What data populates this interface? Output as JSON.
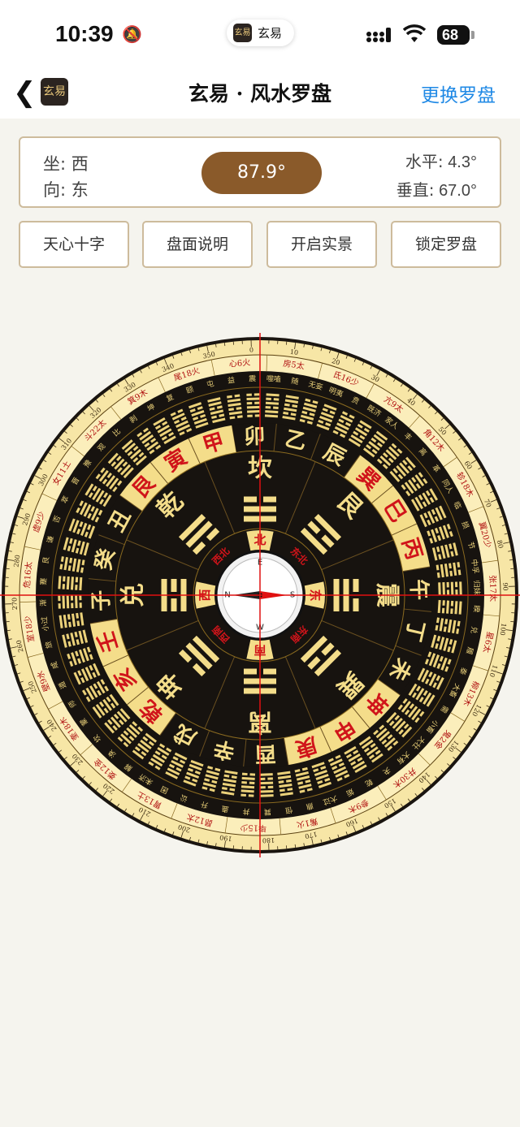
{
  "status": {
    "time": "10:39",
    "app_name": "玄易",
    "battery": "68"
  },
  "nav": {
    "logo": "玄易",
    "title": "玄易 · 风水罗盘",
    "right_action": "更换罗盘"
  },
  "info": {
    "sit_label": "坐:",
    "sit_value": "西",
    "face_label": "向:",
    "face_value": "东",
    "heading": "87.9°",
    "level_label": "水平:",
    "level_value": "4.3°",
    "vertical_label": "垂直:",
    "vertical_value": "67.0°"
  },
  "buttons": [
    "天心十字",
    "盘面说明",
    "开启实景",
    "锁定罗盘"
  ],
  "compass": {
    "cardinals": [
      "E",
      "S",
      "W",
      "N"
    ],
    "directions": [
      "东",
      "东南",
      "南",
      "西南",
      "西",
      "西北",
      "北",
      "东北"
    ],
    "trigrams": [
      "震",
      "巽",
      "离",
      "坤",
      "兑",
      "乾",
      "坎",
      "艮"
    ],
    "mountains": [
      "卯",
      "乙",
      "辰",
      "巽",
      "巳",
      "丙",
      "午",
      "丁",
      "未",
      "坤",
      "申",
      "庚",
      "酉",
      "辛",
      "戌",
      "乾",
      "亥",
      "壬",
      "子",
      "癸",
      "丑",
      "艮",
      "寅",
      "甲"
    ],
    "red_mountains": [
      "巽",
      "巳",
      "丙",
      "坤",
      "申",
      "庚",
      "乾",
      "亥",
      "壬",
      "艮",
      "寅",
      "甲"
    ],
    "hexagrams": [
      "震",
      "噬嗑",
      "随",
      "无妄",
      "明夷",
      "贲",
      "既济",
      "家人",
      "丰",
      "离",
      "革",
      "同人",
      "临",
      "损",
      "节",
      "中孚",
      "归妹",
      "睽",
      "兑",
      "履",
      "泰",
      "大畜",
      "需",
      "小畜",
      "大壮",
      "大有",
      "夬",
      "乾",
      "姤",
      "大过",
      "鼎",
      "恒",
      "巽",
      "井",
      "蛊",
      "升",
      "讼",
      "困",
      "未济",
      "解",
      "涣",
      "坎",
      "蒙",
      "师",
      "遁",
      "咸",
      "旅",
      "小过",
      "渐",
      "蹇",
      "艮",
      "谦",
      "否",
      "萃",
      "晋",
      "豫",
      "观",
      "比",
      "剥",
      "坤",
      "复",
      "颐",
      "屯",
      "益"
    ],
    "mansions": [
      "心6火",
      "房5太",
      "氐16少",
      "亢9太",
      "角12木",
      "轸18木",
      "翼20少",
      "张17太",
      "星6太",
      "柳13木",
      "鬼2金",
      "井30木",
      "参9木",
      "觜1火",
      "毕15少",
      "昴12太",
      "胃13土",
      "娄12金",
      "奎18木",
      "壁9水",
      "室18少",
      "危16太",
      "虚9少",
      "女11土",
      "斗22太",
      "箕9木",
      "尾18火"
    ],
    "degree_labels": [
      "0",
      "10",
      "20",
      "30",
      "40",
      "50",
      "60",
      "70",
      "80",
      "90",
      "100",
      "110",
      "120",
      "130",
      "140",
      "150",
      "160",
      "170",
      "180",
      "190",
      "200",
      "210",
      "220",
      "230",
      "240",
      "250",
      "260",
      "270",
      "280",
      "290",
      "300",
      "310",
      "320",
      "330",
      "340",
      "350"
    ]
  }
}
